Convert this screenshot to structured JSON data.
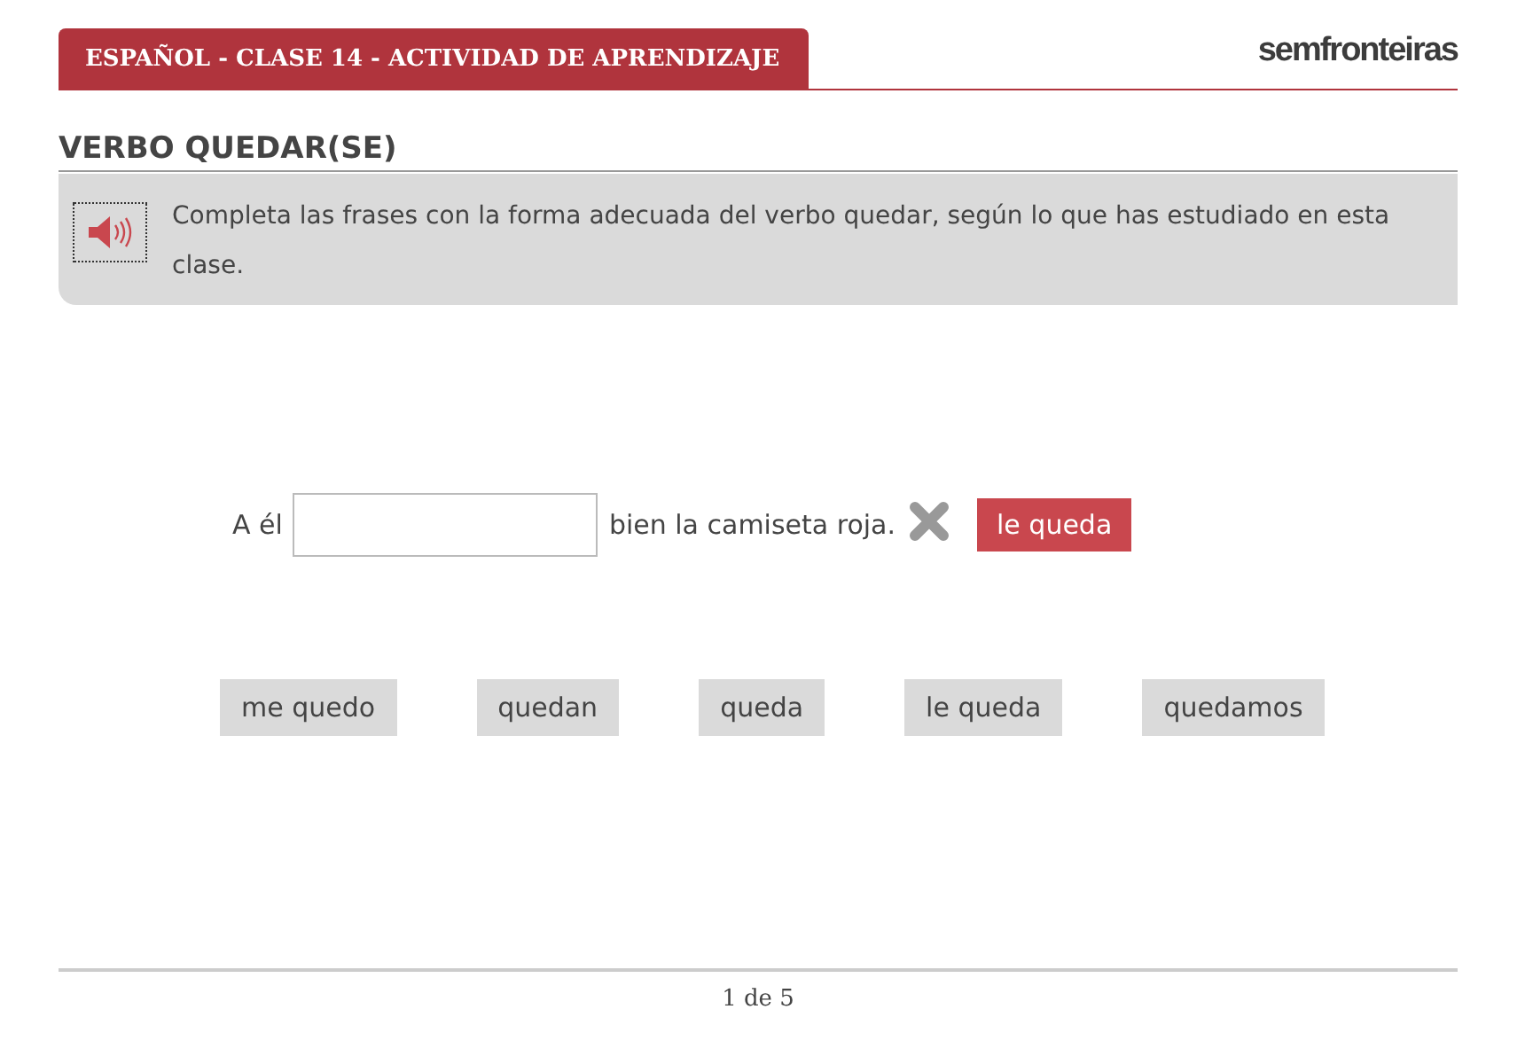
{
  "header": {
    "title": "ESPAÑOL - CLASE 14 - ACTIVIDAD DE APRENDIZAJE",
    "logo": "semfronteiras"
  },
  "activity": {
    "title": "VERBO QUEDAR(SE)",
    "instruction": "Completa las frases con la forma adecuada del verbo quedar, según lo que has estudiado en esta clase."
  },
  "sentence": {
    "before": "A él",
    "after": "bien la camiseta roja.",
    "correct": false,
    "solution": "le queda"
  },
  "options": [
    {
      "label": "me quedo"
    },
    {
      "label": "quedan"
    },
    {
      "label": "queda"
    },
    {
      "label": "le queda"
    },
    {
      "label": "quedamos"
    }
  ],
  "pager": "1 de 5"
}
